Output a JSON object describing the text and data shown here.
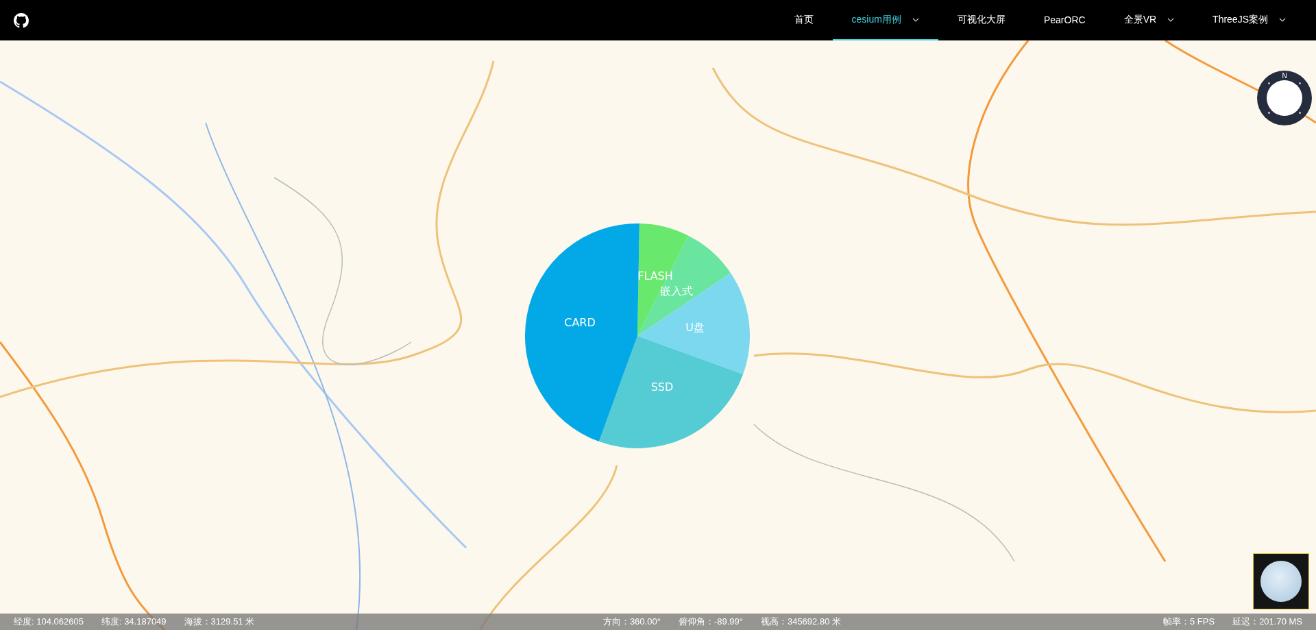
{
  "nav": {
    "items": [
      {
        "label": "首页",
        "selected": false,
        "dropdown": false
      },
      {
        "label": "cesium用例",
        "selected": true,
        "dropdown": true
      },
      {
        "label": "可视化大屏",
        "selected": false,
        "dropdown": false
      },
      {
        "label": "PearORC",
        "selected": false,
        "dropdown": false
      },
      {
        "label": "全景VR",
        "selected": false,
        "dropdown": true
      },
      {
        "label": "ThreeJS案例",
        "selected": false,
        "dropdown": true
      }
    ]
  },
  "compass": {
    "label": "N"
  },
  "pie": {
    "slices": [
      {
        "label": "FLASH",
        "color": "#68e86c"
      },
      {
        "label": "嵌入式",
        "color": "#69e5a0"
      },
      {
        "label": "U盘",
        "color": "#7bd8ee"
      },
      {
        "label": "SSD",
        "color": "#55cbd4"
      },
      {
        "label": "CARD",
        "color": "#03a9e7"
      }
    ]
  },
  "status_bar": {
    "left": [
      "经度: 104.062605",
      "纬度: 34.187049",
      "海拔：3129.51 米"
    ],
    "center": [
      "方向：360.00°",
      "俯仰角：-89.99°",
      "视高：345692.80 米"
    ],
    "right": [
      "帧率：5 FPS",
      "延迟：201.70 MS"
    ]
  }
}
